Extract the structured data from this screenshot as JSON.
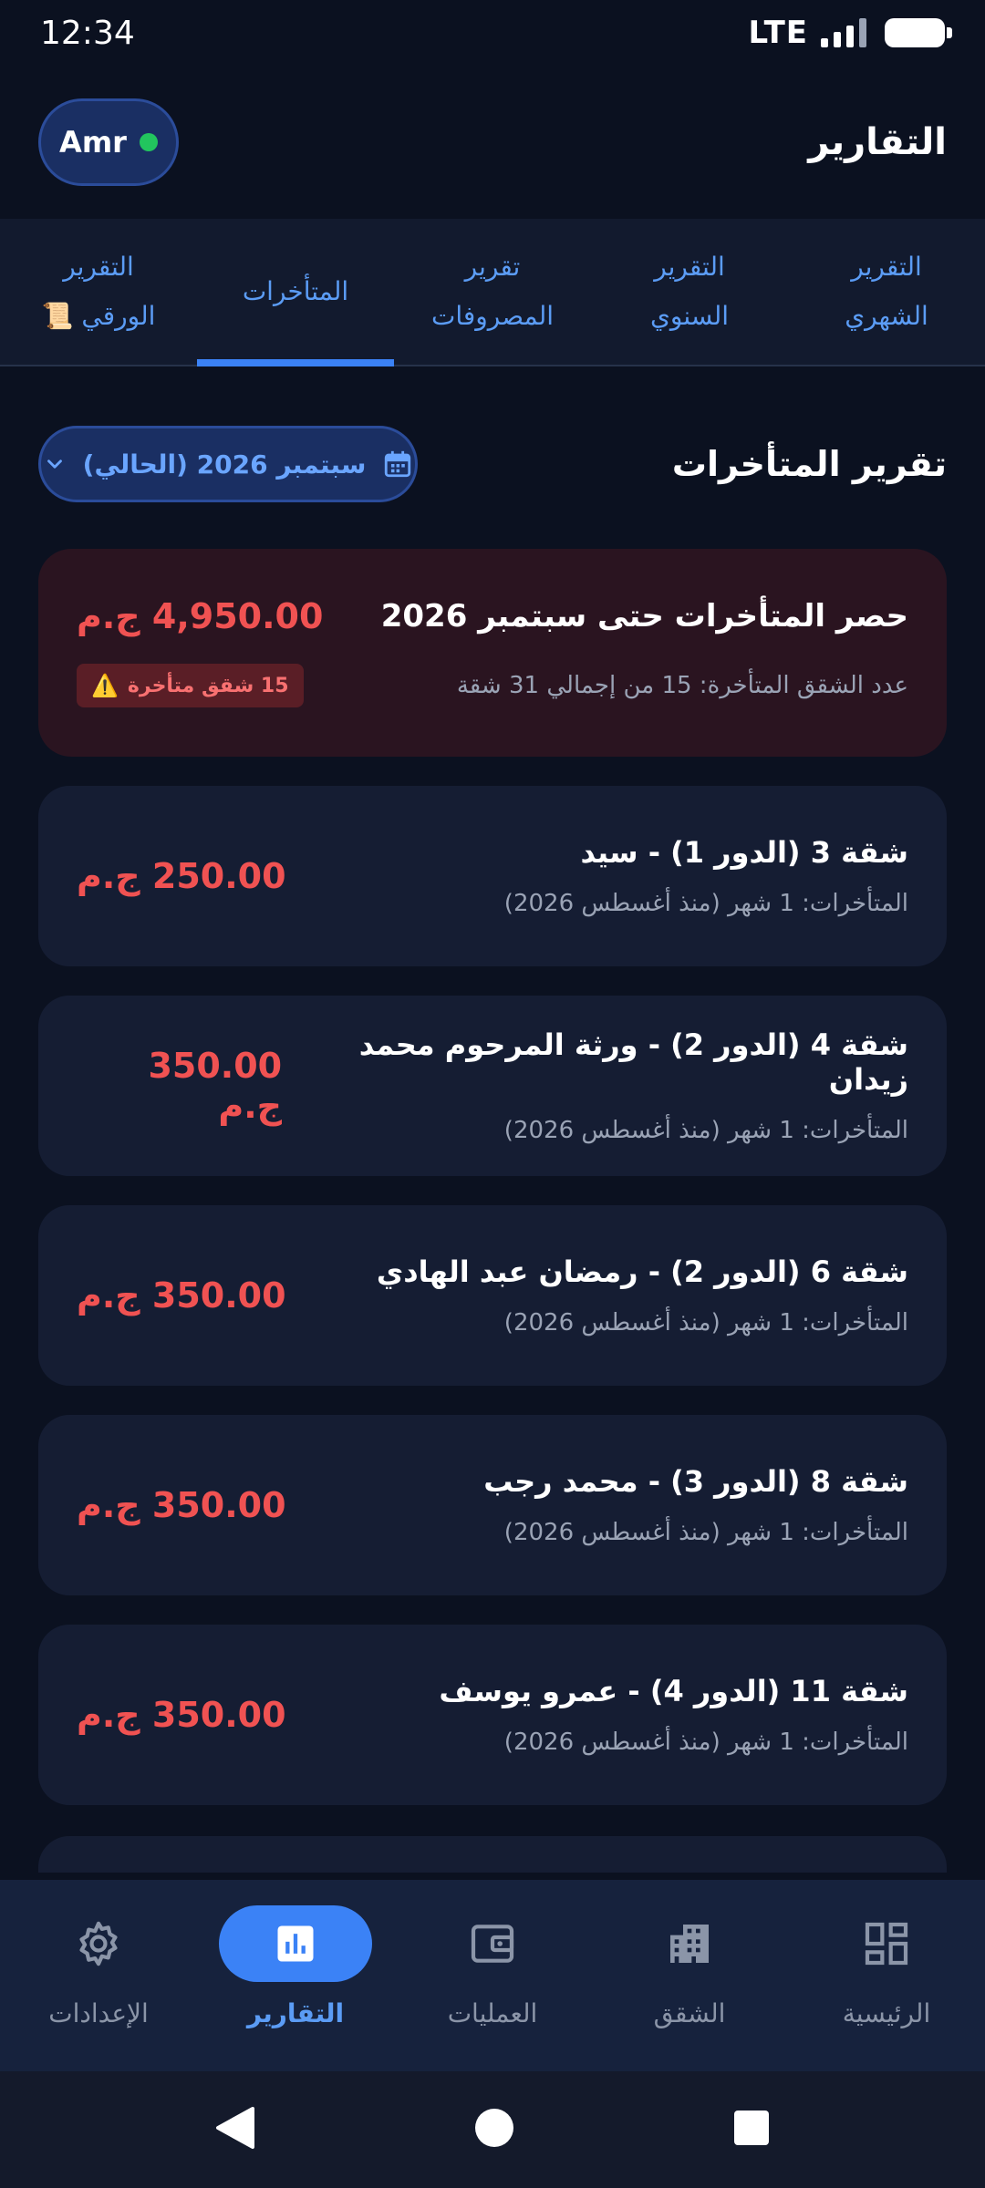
{
  "status_bar": {
    "time": "12:34",
    "network": "LTE"
  },
  "header": {
    "user": "Amr",
    "title": "التقارير"
  },
  "tabs": [
    {
      "line1": "التقرير",
      "line2": "الشهري"
    },
    {
      "line1": "التقرير",
      "line2": "السنوي"
    },
    {
      "line1": "تقرير",
      "line2": "المصروفات"
    },
    {
      "line1": "",
      "line2": "المتأخرات"
    },
    {
      "line1": "التقرير",
      "line2": "الورقي 📜"
    }
  ],
  "active_tab": 3,
  "section": {
    "title": "تقرير المتأخرات",
    "month": "سبتمبر 2026 (الحالي)"
  },
  "summary": {
    "title": "حصر المتأخرات حتى سبتمبر 2026",
    "total": "4,950.00 ج.م",
    "subtitle": "عدد الشقق المتأخرة: 15 من إجمالي 31 شقة",
    "badge": "15 شقق متأخرة",
    "badge_icon": "⚠️"
  },
  "apartments": [
    {
      "name": "شقة 3 (الدور 1) - سيد",
      "detail": "المتأخرات: 1 شهر (منذ أغسطس 2026)",
      "amount": "250.00 ج.م"
    },
    {
      "name": "شقة 4 (الدور 2) - ورثة المرحوم محمد زيدان",
      "detail": "المتأخرات: 1 شهر (منذ أغسطس 2026)",
      "amount": "350.00 ج.م"
    },
    {
      "name": "شقة 6 (الدور 2) - رمضان عبد الهادي",
      "detail": "المتأخرات: 1 شهر (منذ أغسطس 2026)",
      "amount": "350.00 ج.م"
    },
    {
      "name": "شقة 8 (الدور 3) - محمد رجب",
      "detail": "المتأخرات: 1 شهر (منذ أغسطس 2026)",
      "amount": "350.00 ج.م"
    },
    {
      "name": "شقة 11 (الدور 4) - عمرو يوسف",
      "detail": "المتأخرات: 1 شهر (منذ أغسطس 2026)",
      "amount": "350.00 ج.م"
    }
  ],
  "bottom_nav": [
    {
      "label": "الرئيسية",
      "icon": "dashboard-icon"
    },
    {
      "label": "الشقق",
      "icon": "building-icon"
    },
    {
      "label": "العمليات",
      "icon": "wallet-icon"
    },
    {
      "label": "التقارير",
      "icon": "bar-chart-icon"
    },
    {
      "label": "الإعدادات",
      "icon": "gear-icon"
    }
  ],
  "active_nav": 3,
  "colors": {
    "background": "#0b1120",
    "accent": "#3b82f6",
    "danger": "#f05252",
    "online": "#22c55e",
    "card": "#151d33",
    "summary_card": "#2a1420"
  }
}
